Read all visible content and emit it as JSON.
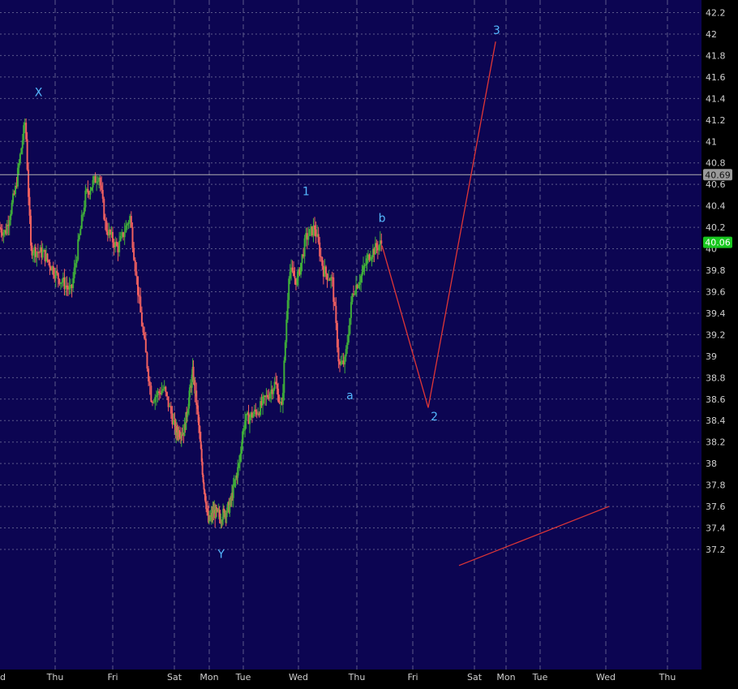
{
  "colors": {
    "background": "#0c0552",
    "axis_bg": "#000000",
    "grid": "#6f6f9a",
    "up": "#3fae3a",
    "down": "#f06060",
    "projection": "#e03636",
    "wave_label": "#55b8ff",
    "axis_text": "#cfcfcf",
    "last_price_bg": "#18c71f",
    "level_bg": "#9a9a9a"
  },
  "chart_data": {
    "type": "candlestick",
    "ylim": [
      37.05,
      42.3
    ],
    "y_ticks": [
      37.2,
      37.4,
      37.6,
      37.8,
      38,
      38.2,
      38.4,
      38.6,
      38.8,
      39,
      39.2,
      39.4,
      39.6,
      39.8,
      40,
      40.2,
      40.4,
      40.6,
      40.8,
      41,
      41.2,
      41.4,
      41.6,
      41.8,
      42,
      42.2
    ],
    "y_tick_labels": [
      "37.2",
      "37.4",
      "37.6",
      "37.8",
      "38",
      "38.2",
      "38.4",
      "38.6",
      "38.8",
      "39",
      "39.2",
      "39.4",
      "39.6",
      "39.8",
      "40",
      "40.2",
      "40.4",
      "40.6",
      "40.8",
      "41",
      "41.2",
      "41.4",
      "41.6",
      "41.8",
      "42",
      "42.2"
    ],
    "x_labels": [
      "d",
      "Thu",
      "Fri",
      "Sat",
      "Mon",
      "Tue",
      "Wed",
      "Thu",
      "Fri",
      "Sat",
      "Mon",
      "Tue",
      "Wed",
      "Thu"
    ],
    "last_price": "40.06",
    "horizontal_level": "40.69",
    "wave_labels": [
      {
        "text": "X",
        "x": 0.7,
        "y": 41.42
      },
      {
        "text": "Y",
        "x": 4.35,
        "y": 37.12
      },
      {
        "text": "1",
        "x": 6.13,
        "y": 40.5
      },
      {
        "text": "a",
        "x": 6.88,
        "y": 38.6
      },
      {
        "text": "b",
        "x": 7.45,
        "y": 40.25
      },
      {
        "text": "2",
        "x": 8.35,
        "y": 38.4
      },
      {
        "text": "3",
        "x": 9.7,
        "y": 42.0
      }
    ],
    "projection": [
      [
        7.45,
        40.03
      ],
      [
        8.25,
        38.52
      ],
      [
        9.67,
        41.93
      ]
    ],
    "trendline": [
      [
        8.75,
        37.05
      ],
      [
        12.05,
        37.6
      ]
    ],
    "waypoints": [
      [
        0.0,
        40.2
      ],
      [
        0.12,
        40.15
      ],
      [
        0.3,
        40.55
      ],
      [
        0.48,
        41.2
      ],
      [
        0.58,
        40.0
      ],
      [
        0.82,
        39.95
      ],
      [
        1.05,
        39.75
      ],
      [
        1.3,
        39.6
      ],
      [
        1.55,
        40.5
      ],
      [
        1.78,
        40.7
      ],
      [
        1.9,
        40.2
      ],
      [
        2.1,
        40.0
      ],
      [
        2.3,
        40.3
      ],
      [
        2.45,
        39.5
      ],
      [
        2.65,
        38.6
      ],
      [
        2.85,
        38.7
      ],
      [
        3.05,
        38.3
      ],
      [
        3.3,
        38.3
      ],
      [
        3.55,
        38.85
      ],
      [
        3.68,
        38.5
      ],
      [
        3.85,
        37.85
      ],
      [
        4.0,
        37.45
      ],
      [
        4.15,
        37.55
      ],
      [
        4.35,
        37.5
      ],
      [
        4.62,
        37.6
      ],
      [
        4.9,
        38.0
      ],
      [
        5.05,
        38.4
      ],
      [
        5.3,
        38.5
      ],
      [
        5.6,
        38.75
      ],
      [
        5.72,
        38.5
      ],
      [
        5.85,
        39.8
      ],
      [
        6.0,
        39.7
      ],
      [
        6.15,
        40.1
      ],
      [
        6.3,
        40.2
      ],
      [
        6.45,
        39.8
      ],
      [
        6.6,
        39.7
      ],
      [
        6.72,
        38.9
      ],
      [
        6.82,
        38.95
      ],
      [
        6.95,
        39.6
      ],
      [
        7.1,
        39.75
      ],
      [
        7.25,
        39.95
      ],
      [
        7.45,
        40.05
      ]
    ]
  }
}
